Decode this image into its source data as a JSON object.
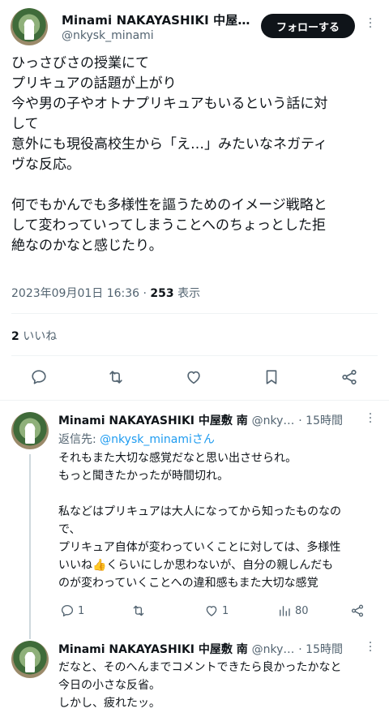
{
  "main_post": {
    "author_name": "Minami NAKAYASHIKI 中屋…",
    "handle": "@nkysk_minami",
    "follow_label": "フォローする",
    "text": "ひっさびさの授業にて\nプリキュアの話題が上がり\n今や男の子やオトナプリキュアもいるという話に対\nして\n意外にも現役高校生から「え…」みたいなネガティ\nヴな反応。\n\n何でもかんでも多様性を謳うためのイメージ戦略と\nして変わっていってしまうことへのちょっとした拒\n絶なのかなと感じたり。",
    "timestamp": "2023年09月01日 16:36",
    "separator": "·",
    "views_count": "253",
    "views_label": "表示",
    "likes_count": "2",
    "likes_label": "いいね"
  },
  "replies": [
    {
      "author_name": "Minami NAKAYASHIKI 中屋敷 南",
      "handle": "@nky…",
      "time": "· 15時間",
      "reply_to_label": "返信先:",
      "reply_to_handle": "@nkysk_minamiさん",
      "text": "それもまた大切な感覚だなと思い出させられ。\nもっと聞きたかったが時間切れ。\n\n私などはプリキュアは大人になってから知ったものなの\nで、\nプリキュア自体が変わっていくことに対しては、多様性\nいいね👍くらいにしか思わないが、自分の親しんだも\nのが変わっていくことへの違和感もまた大切な感覚",
      "reply_count": "1",
      "retweet_count": "",
      "like_count": "1",
      "view_count": "80"
    },
    {
      "author_name": "Minami NAKAYASHIKI 中屋敷 南",
      "handle": "@nky…",
      "time": "· 15時間",
      "text": "だなと、そのへんまでコメントできたら良かったかなと\n今日の小さな反省。\nしかし、疲れたッ。"
    }
  ],
  "icons": {
    "reply": "reply-icon",
    "retweet": "retweet-icon",
    "like": "heart-icon",
    "bookmark": "bookmark-icon",
    "share": "share-icon",
    "views": "views-chart-icon",
    "more": "more-dots-icon"
  },
  "colors": {
    "text": "#0f1419",
    "secondary": "#536471",
    "link": "#1d9bf0",
    "button_bg": "#0f1419",
    "divider": "#eff3f4"
  }
}
